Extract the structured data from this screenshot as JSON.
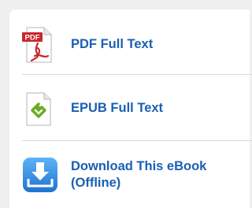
{
  "downloads": {
    "items": [
      {
        "label": "PDF Full Text",
        "icon": "pdf-file-icon"
      },
      {
        "label": "EPUB Full Text",
        "icon": "epub-file-icon"
      },
      {
        "label": "Download This eBook (Offline)",
        "icon": "download-arrow-icon"
      }
    ],
    "pdf_badge": "PDF"
  },
  "colors": {
    "link": "#1a5fb4",
    "pdf_red": "#c8262c",
    "epub_green": "#6aab23",
    "download_blue": "#2f8be0"
  }
}
